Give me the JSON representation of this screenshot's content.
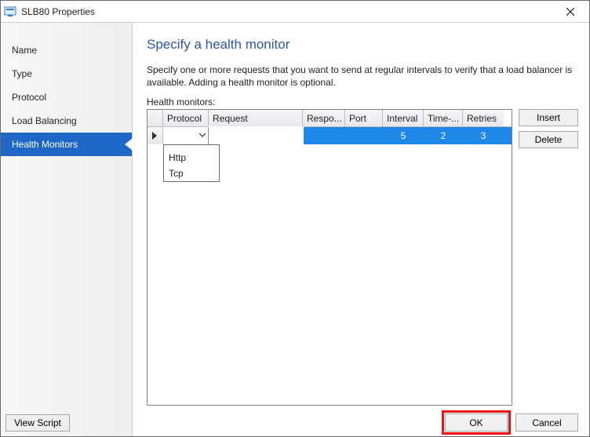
{
  "window": {
    "title": "SLB80 Properties"
  },
  "sidebar": {
    "items": [
      {
        "label": "Name"
      },
      {
        "label": "Type"
      },
      {
        "label": "Protocol"
      },
      {
        "label": "Load Balancing"
      },
      {
        "label": "Health Monitors"
      }
    ],
    "view_script": "View Script"
  },
  "page": {
    "heading": "Specify a health monitor",
    "description": "Specify one or more requests that you want to send at regular intervals to verify that a load balancer is available. Adding a health monitor is optional.",
    "list_label": "Health monitors:"
  },
  "grid": {
    "headers": {
      "protocol": "Protocol",
      "request": "Request",
      "response": "Respo...",
      "port": "Port",
      "interval": "Interval",
      "timeout": "Time-...",
      "retries": "Retries"
    },
    "row": {
      "protocol_value": "",
      "request_value": "",
      "response": "",
      "port": "",
      "interval": "5",
      "timeout": "2",
      "retries": "3"
    },
    "protocol_options": [
      "",
      "Http",
      "Tcp"
    ]
  },
  "buttons": {
    "insert": "Insert",
    "delete": "Delete",
    "ok": "OK",
    "cancel": "Cancel"
  }
}
